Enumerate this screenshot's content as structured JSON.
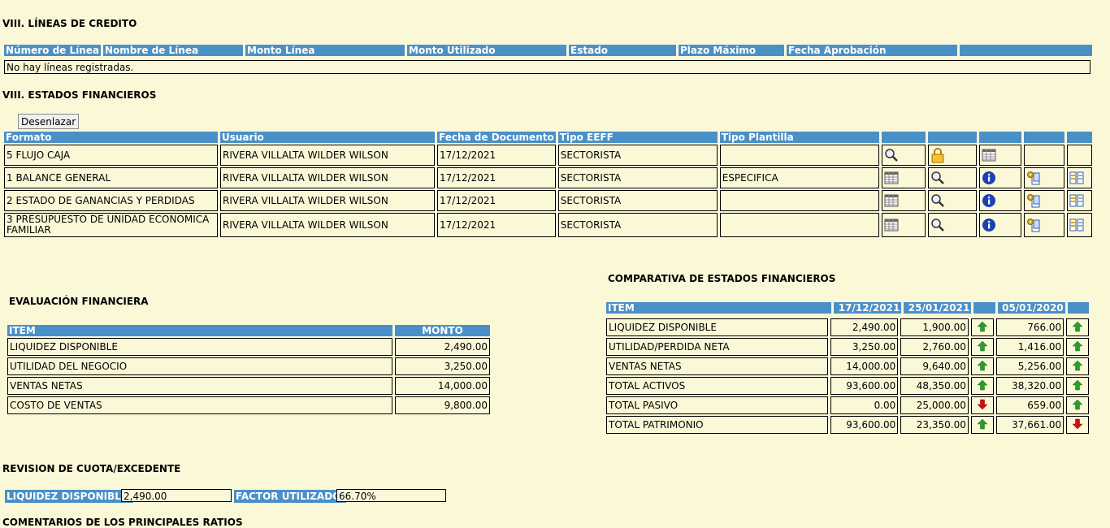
{
  "lineas": {
    "title": "VIII. LÍNEAS DE CREDITO",
    "headers": [
      "Número de Línea",
      "Nombre de Línea",
      "Monto Línea",
      "Monto Utilizado",
      "Estado",
      "Plazo Máximo",
      "Fecha Aprobación",
      ""
    ],
    "empty_message": "No hay líneas registradas."
  },
  "estados": {
    "title": "VIII. ESTADOS FINANCIEROS",
    "unlink_button": "Desenlazar",
    "headers": [
      "Formato",
      "Usuario",
      "Fecha de Documento",
      "Tipo EEFF",
      "Tipo Plantilla",
      "",
      "",
      "",
      "",
      ""
    ],
    "rows": [
      {
        "formato": "5  FLUJO CAJA",
        "usuario": "RIVERA VILLALTA WILDER WILSON",
        "fecha": "17/12/2021",
        "tipo": "SECTORISTA",
        "plantilla": "",
        "icons": [
          "magnifier-icon",
          "lock-icon",
          "spreadsheet-icon",
          "",
          ""
        ]
      },
      {
        "formato": "1  BALANCE GENERAL",
        "usuario": "RIVERA VILLALTA WILDER WILSON",
        "fecha": "17/12/2021",
        "tipo": "SECTORISTA",
        "plantilla": "ESPECIFICA",
        "icons": [
          "spreadsheet-icon",
          "magnifier-icon",
          "info-icon",
          "copy-gear-icon",
          "grid-list-icon"
        ]
      },
      {
        "formato": "2  ESTADO DE GANANCIAS Y PERDIDAS",
        "usuario": "RIVERA VILLALTA WILDER WILSON",
        "fecha": "17/12/2021",
        "tipo": "SECTORISTA",
        "plantilla": "",
        "icons": [
          "spreadsheet-icon",
          "magnifier-icon",
          "info-icon",
          "copy-gear-icon",
          "grid-list-icon"
        ]
      },
      {
        "formato": "3  PRESUPUESTO DE UNIDAD ECONOMICA FAMILIAR",
        "usuario": "RIVERA VILLALTA WILDER WILSON",
        "fecha": "17/12/2021",
        "tipo": "SECTORISTA",
        "plantilla": "",
        "icons": [
          "spreadsheet-icon",
          "magnifier-icon",
          "info-icon",
          "copy-gear-icon",
          "grid-list-icon"
        ]
      }
    ]
  },
  "evaluacion": {
    "title": "EVALUACIÓN FINANCIERA",
    "headers": [
      "ITEM",
      "MONTO"
    ],
    "rows": [
      {
        "item": "LIQUIDEZ DISPONIBLE",
        "monto": "2,490.00"
      },
      {
        "item": "UTILIDAD DEL NEGOCIO",
        "monto": "3,250.00"
      },
      {
        "item": "VENTAS NETAS",
        "monto": "14,000.00"
      },
      {
        "item": "COSTO DE VENTAS",
        "monto": "9,800.00"
      }
    ]
  },
  "comparativa": {
    "title": "COMPARATIVA DE ESTADOS FINANCIEROS",
    "headers": [
      "ITEM",
      "17/12/2021",
      "25/01/2021",
      "",
      "05/01/2020",
      ""
    ],
    "rows": [
      {
        "item": "LIQUIDEZ DISPONIBLE",
        "v1": "2,490.00",
        "v2": "1,900.00",
        "a1": "up",
        "v3": "766.00",
        "a2": "up"
      },
      {
        "item": "UTILIDAD/PERDIDA NETA",
        "v1": "3,250.00",
        "v2": "2,760.00",
        "a1": "up",
        "v3": "1,416.00",
        "a2": "up"
      },
      {
        "item": "VENTAS NETAS",
        "v1": "14,000.00",
        "v2": "9,640.00",
        "a1": "up",
        "v3": "5,256.00",
        "a2": "up"
      },
      {
        "item": "TOTAL ACTIVOS",
        "v1": "93,600.00",
        "v2": "48,350.00",
        "a1": "up",
        "v3": "38,320.00",
        "a2": "up"
      },
      {
        "item": "TOTAL PASIVO",
        "v1": "0.00",
        "v2": "25,000.00",
        "a1": "down",
        "v3": "659.00",
        "a2": "up"
      },
      {
        "item": "TOTAL PATRIMONIO",
        "v1": "93,600.00",
        "v2": "23,350.00",
        "a1": "up",
        "v3": "37,661.00",
        "a2": "down"
      }
    ]
  },
  "revision": {
    "title": "REVISION DE CUOTA/EXCEDENTE",
    "liquidez_label": "LIQUIDEZ DISPONIBLE:",
    "liquidez_value": "2,490.00",
    "factor_label": "FACTOR UTILIZADO:",
    "factor_value": "66.70%"
  },
  "comentarios": {
    "title": "COMENTARIOS DE LOS PRINCIPALES RATIOS"
  },
  "colors": {
    "background": "#fbf8d8",
    "header": "#4a90c8",
    "arrow_up": "#2a9d2a",
    "arrow_down": "#cc1111"
  }
}
